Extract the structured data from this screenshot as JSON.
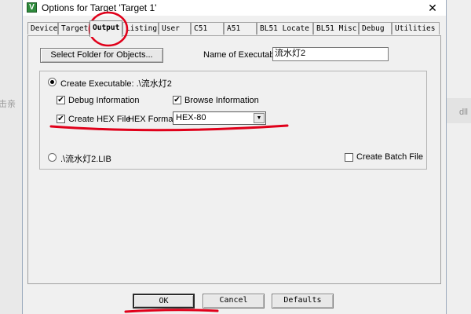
{
  "background": {
    "left_text": "击亲",
    "right_text": "dll"
  },
  "window": {
    "title": "Options for Target 'Target 1'",
    "app_icon": "V",
    "close_glyph": "✕"
  },
  "tabs": [
    {
      "label": "Device"
    },
    {
      "label": "Target"
    },
    {
      "label": "Output",
      "active": true
    },
    {
      "label": "Listing"
    },
    {
      "label": "User"
    },
    {
      "label": "C51"
    },
    {
      "label": "A51"
    },
    {
      "label": "BL51 Locate"
    },
    {
      "label": "BL51 Misc"
    },
    {
      "label": "Debug"
    },
    {
      "label": "Utilities"
    }
  ],
  "output": {
    "select_folder_label": "Select Folder for Objects...",
    "name_of_executable_label": "Name of Executable:",
    "name_of_executable_value": "流水灯2",
    "create_executable": {
      "label": "Create Executable:  .\\流水灯2",
      "selected": true
    },
    "debug_information": {
      "label": "Debug Information",
      "checked": true
    },
    "browse_information": {
      "label": "Browse Information",
      "checked": true
    },
    "create_hex_file": {
      "label": "Create HEX File",
      "checked": true
    },
    "hex_format_label": "HEX Format:",
    "hex_format_value": "HEX-80",
    "create_library": {
      "label": ".\\流水灯2.LIB",
      "selected": false
    },
    "create_batch_file": {
      "label": "Create Batch File",
      "checked": false
    }
  },
  "footer": {
    "ok_label": "OK",
    "cancel_label": "Cancel",
    "defaults_label": "Defaults"
  },
  "colors": {
    "annotation_red": "#e0001a",
    "window_bg": "#f0f0f0",
    "app_icon_green": "#2e8b3c"
  },
  "icons": {
    "app_icon": "keil-uvision-icon",
    "close": "close-icon",
    "dropdown": "chevron-down-icon"
  }
}
